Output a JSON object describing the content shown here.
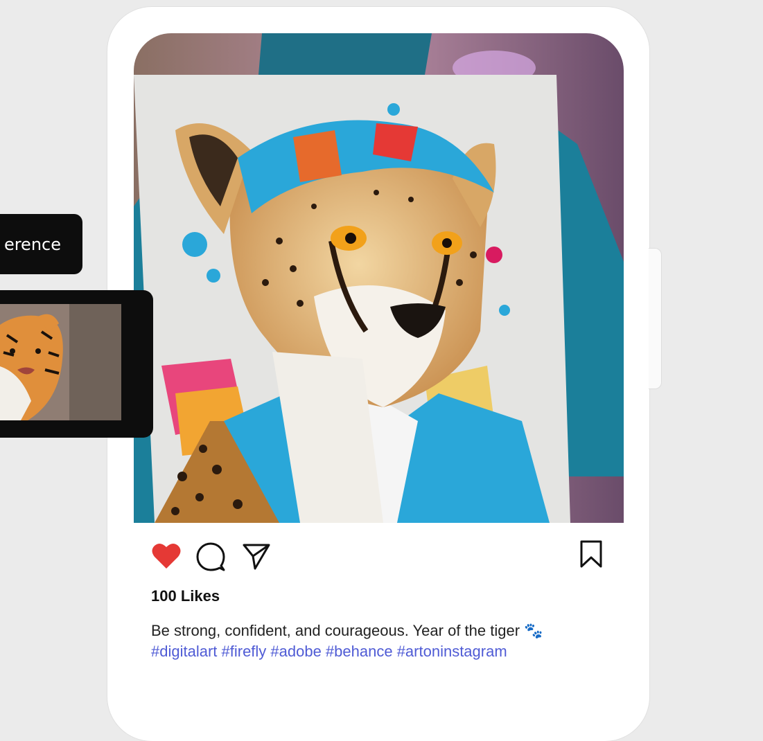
{
  "tooltip": {
    "label": "erence"
  },
  "post": {
    "likes": "100 Likes",
    "caption": "Be strong, confident, and courageous. Year of the tiger 🐾",
    "hashtags": "#digitalart #firefly #adobe #behance #artoninstagram"
  },
  "actions": {
    "like_icon": "heart-filled-icon",
    "comment_icon": "comment-icon",
    "share_icon": "send-icon",
    "save_icon": "bookmark-icon"
  },
  "colors": {
    "like": "#e53935",
    "hashtag": "#4f5bd5",
    "shirt_teal": "#1b7f9a",
    "cap_blue": "#2aa7d9"
  }
}
